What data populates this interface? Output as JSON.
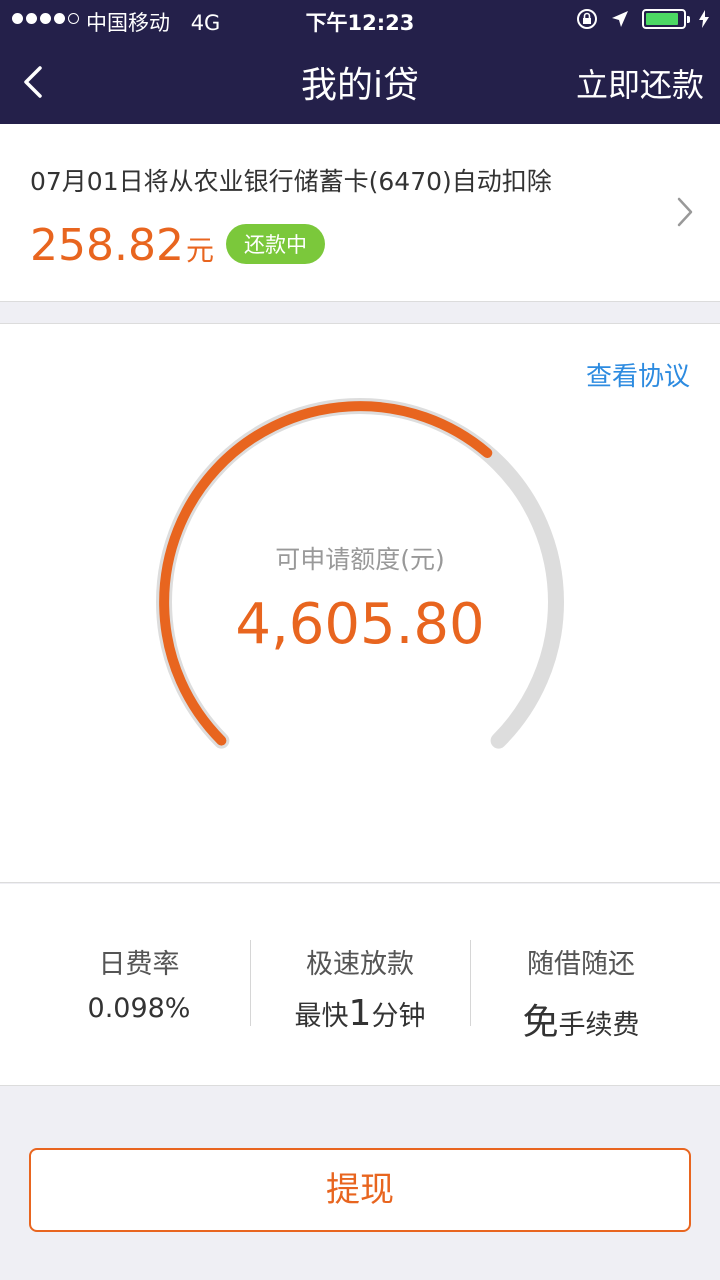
{
  "status_bar": {
    "carrier": "中国移动",
    "network": "4G",
    "time": "下午12:23",
    "battery_level": 0.9,
    "signal_bars": 4
  },
  "navbar": {
    "title": "我的i贷",
    "action_label": "立即还款"
  },
  "repayment": {
    "description": "07月01日将从农业银行储蓄卡(6470)自动扣除",
    "amount": "258.82",
    "unit": "元",
    "status": "还款中"
  },
  "credit": {
    "agreement_link": "查看协议",
    "label": "可申请额度(元)",
    "available": "4,605.80",
    "gauge_fraction": 0.65
  },
  "features": [
    {
      "title": "日费率",
      "value": "0.098%"
    },
    {
      "title": "极速放款",
      "value_prefix": "最快",
      "value_big": "1",
      "value_suffix": "分钟"
    },
    {
      "title": "随借随还",
      "value_big": "免",
      "value_suffix": "手续费"
    }
  ],
  "withdraw_label": "提现",
  "colors": {
    "header_bg": "#24204a",
    "accent": "#e8651f",
    "status_green": "#7bc83b",
    "link_blue": "#2d8be0",
    "track_gray": "#dddddd"
  },
  "icons": [
    "back-icon",
    "location-arrow-icon",
    "orientation-lock-icon",
    "battery-icon",
    "charging-icon",
    "chevron-right-icon"
  ]
}
